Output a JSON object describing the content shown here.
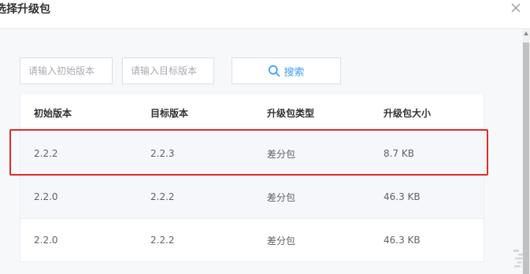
{
  "dialog": {
    "title": "选择升级包"
  },
  "filters": {
    "start_version_placeholder": "请输入初始版本",
    "target_version_placeholder": "请输入目标版本",
    "search_label": "搜索"
  },
  "table": {
    "columns": [
      "初始版本",
      "目标版本",
      "升级包类型",
      "升级包大小"
    ],
    "rows": [
      [
        "2.2.2",
        "2.2.3",
        "差分包",
        "8.7 KB"
      ],
      [
        "2.2.0",
        "2.2.2",
        "差分包",
        "46.3 KB"
      ],
      [
        "2.2.0",
        "2.2.2",
        "差分包",
        "46.3 KB"
      ]
    ]
  },
  "colors": {
    "accent": "#409eff",
    "highlight_border": "#e02a2a",
    "row_hover": "#f5f7fa"
  },
  "icons": {
    "close": "close-icon",
    "search": "search-icon"
  }
}
